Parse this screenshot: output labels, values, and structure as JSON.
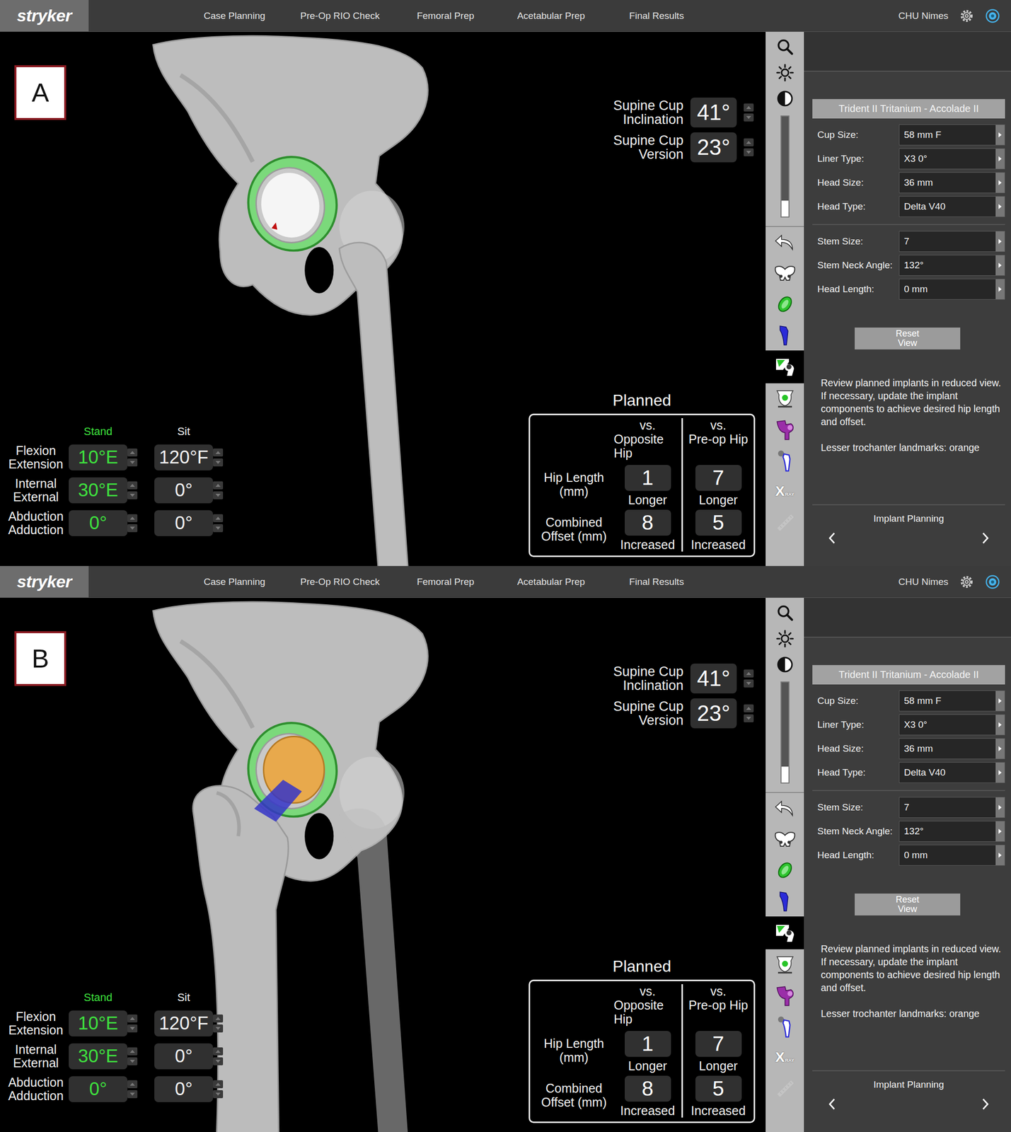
{
  "panels": [
    {
      "badge": "A",
      "view": "cup",
      "header": {
        "logo": "stryker",
        "nav": [
          "Case Planning",
          "Pre-Op RIO Check",
          "Femoral Prep",
          "Acetabular Prep",
          "Final Results"
        ],
        "site": "CHU Nimes"
      },
      "cup": [
        {
          "lines": [
            "Supine Cup",
            "Inclination"
          ],
          "value": "41°"
        },
        {
          "lines": [
            "Supine Cup",
            "Version"
          ],
          "value": "23°"
        }
      ],
      "motion": {
        "columns": [
          {
            "label": "Stand",
            "selected": true
          },
          {
            "label": "Sit",
            "selected": false
          }
        ],
        "rows": [
          {
            "lines": [
              "Flexion",
              "Extension"
            ],
            "values": [
              "10°E",
              "120°F"
            ]
          },
          {
            "lines": [
              "Internal",
              "External"
            ],
            "values": [
              "30°E",
              "0°"
            ]
          },
          {
            "lines": [
              "Abduction",
              "Adduction"
            ],
            "values": [
              "0°",
              "0°"
            ]
          }
        ]
      },
      "planned": {
        "title": "Planned",
        "columns": [
          [
            "vs.",
            "Opposite Hip"
          ],
          [
            "vs.",
            "Pre-op Hip"
          ]
        ],
        "rows": [
          {
            "lines": [
              "Hip Length",
              "(mm)"
            ],
            "cells": [
              {
                "value": "1",
                "note": "Longer"
              },
              {
                "value": "7",
                "note": "Longer"
              }
            ]
          },
          {
            "lines": [
              "Combined",
              "Offset (mm)"
            ],
            "cells": [
              {
                "value": "8",
                "note": "Increased"
              },
              {
                "value": "5",
                "note": "Increased"
              }
            ]
          }
        ]
      },
      "toolbar": [
        {
          "kind": "search",
          "selected": false,
          "disabled": false
        },
        {
          "kind": "brightness",
          "selected": false,
          "disabled": false
        },
        {
          "kind": "contrast",
          "selected": false,
          "disabled": false
        },
        {
          "kind": "slider",
          "selected": false,
          "disabled": false,
          "level": 0.16
        },
        {
          "kind": "undo",
          "selected": false,
          "disabled": false
        },
        {
          "kind": "pelvis",
          "selected": false,
          "disabled": false
        },
        {
          "kind": "cup",
          "selected": false,
          "disabled": false
        },
        {
          "kind": "stem",
          "selected": false,
          "disabled": false
        },
        {
          "kind": "reduce",
          "selected": true,
          "disabled": false
        },
        {
          "kind": "target",
          "selected": false,
          "disabled": false
        },
        {
          "kind": "femur",
          "selected": false,
          "disabled": false
        },
        {
          "kind": "landmark",
          "selected": false,
          "disabled": false
        },
        {
          "kind": "xray",
          "selected": false,
          "disabled": false,
          "label": "X",
          "sub": "RAY"
        },
        {
          "kind": "ruler",
          "selected": false,
          "disabled": true
        }
      ],
      "side": {
        "title": "Trident II Tritanium - Accolade II",
        "groups": [
          [
            {
              "label": "Cup Size:",
              "value": "58 mm F"
            },
            {
              "label": "Liner Type:",
              "value": "X3 0°"
            },
            {
              "label": "Head Size:",
              "value": "36 mm"
            },
            {
              "label": "Head Type:",
              "value": "Delta V40"
            }
          ],
          [
            {
              "label": "Stem Size:",
              "value": "7"
            },
            {
              "label": "Stem Neck Angle:",
              "value": "132°"
            },
            {
              "label": "Head Length:",
              "value": "0 mm"
            }
          ]
        ],
        "button": "Reset View",
        "instructions": [
          "Review planned implants in reduced view.",
          "If necessary, update the implant components to achieve desired hip length and offset.",
          "Lesser trochanter landmarks: orange"
        ],
        "footer": "Implant Planning"
      }
    },
    {
      "badge": "B",
      "view": "reduced",
      "header": {
        "logo": "stryker",
        "nav": [
          "Case Planning",
          "Pre-Op RIO Check",
          "Femoral Prep",
          "Acetabular Prep",
          "Final Results"
        ],
        "site": "CHU Nimes"
      },
      "cup": [
        {
          "lines": [
            "Supine Cup",
            "Inclination"
          ],
          "value": "41°"
        },
        {
          "lines": [
            "Supine Cup",
            "Version"
          ],
          "value": "23°"
        }
      ],
      "motion": {
        "columns": [
          {
            "label": "Stand",
            "selected": true
          },
          {
            "label": "Sit",
            "selected": false
          }
        ],
        "rows": [
          {
            "lines": [
              "Flexion",
              "Extension"
            ],
            "values": [
              "10°E",
              "120°F"
            ]
          },
          {
            "lines": [
              "Internal",
              "External"
            ],
            "values": [
              "30°E",
              "0°"
            ]
          },
          {
            "lines": [
              "Abduction",
              "Adduction"
            ],
            "values": [
              "0°",
              "0°"
            ]
          }
        ]
      },
      "planned": {
        "title": "Planned",
        "columns": [
          [
            "vs.",
            "Opposite Hip"
          ],
          [
            "vs.",
            "Pre-op Hip"
          ]
        ],
        "rows": [
          {
            "lines": [
              "Hip Length",
              "(mm)"
            ],
            "cells": [
              {
                "value": "1",
                "note": "Longer"
              },
              {
                "value": "7",
                "note": "Longer"
              }
            ]
          },
          {
            "lines": [
              "Combined",
              "Offset (mm)"
            ],
            "cells": [
              {
                "value": "8",
                "note": "Increased"
              },
              {
                "value": "5",
                "note": "Increased"
              }
            ]
          }
        ]
      },
      "toolbar": [
        {
          "kind": "search",
          "selected": false,
          "disabled": false
        },
        {
          "kind": "brightness",
          "selected": false,
          "disabled": false
        },
        {
          "kind": "contrast",
          "selected": false,
          "disabled": false
        },
        {
          "kind": "slider",
          "selected": false,
          "disabled": false,
          "level": 0.16
        },
        {
          "kind": "undo",
          "selected": false,
          "disabled": false
        },
        {
          "kind": "pelvis",
          "selected": false,
          "disabled": false
        },
        {
          "kind": "cup",
          "selected": false,
          "disabled": false
        },
        {
          "kind": "stem",
          "selected": false,
          "disabled": false
        },
        {
          "kind": "reduce",
          "selected": true,
          "disabled": false
        },
        {
          "kind": "target",
          "selected": false,
          "disabled": false
        },
        {
          "kind": "femur",
          "selected": false,
          "disabled": false
        },
        {
          "kind": "landmark",
          "selected": false,
          "disabled": false
        },
        {
          "kind": "xray",
          "selected": false,
          "disabled": false,
          "label": "X",
          "sub": "RAY"
        },
        {
          "kind": "ruler",
          "selected": false,
          "disabled": true
        }
      ],
      "side": {
        "title": "Trident II Tritanium - Accolade II",
        "groups": [
          [
            {
              "label": "Cup Size:",
              "value": "58 mm F"
            },
            {
              "label": "Liner Type:",
              "value": "X3 0°"
            },
            {
              "label": "Head Size:",
              "value": "36 mm"
            },
            {
              "label": "Head Type:",
              "value": "Delta V40"
            }
          ],
          [
            {
              "label": "Stem Size:",
              "value": "7"
            },
            {
              "label": "Stem Neck Angle:",
              "value": "132°"
            },
            {
              "label": "Head Length:",
              "value": "0 mm"
            }
          ]
        ],
        "button": "Reset View",
        "instructions": [
          "Review planned implants in reduced view.",
          "If necessary, update the implant components to achieve desired hip length and offset.",
          "Lesser trochanter landmarks: orange"
        ],
        "footer": "Implant Planning"
      }
    }
  ]
}
